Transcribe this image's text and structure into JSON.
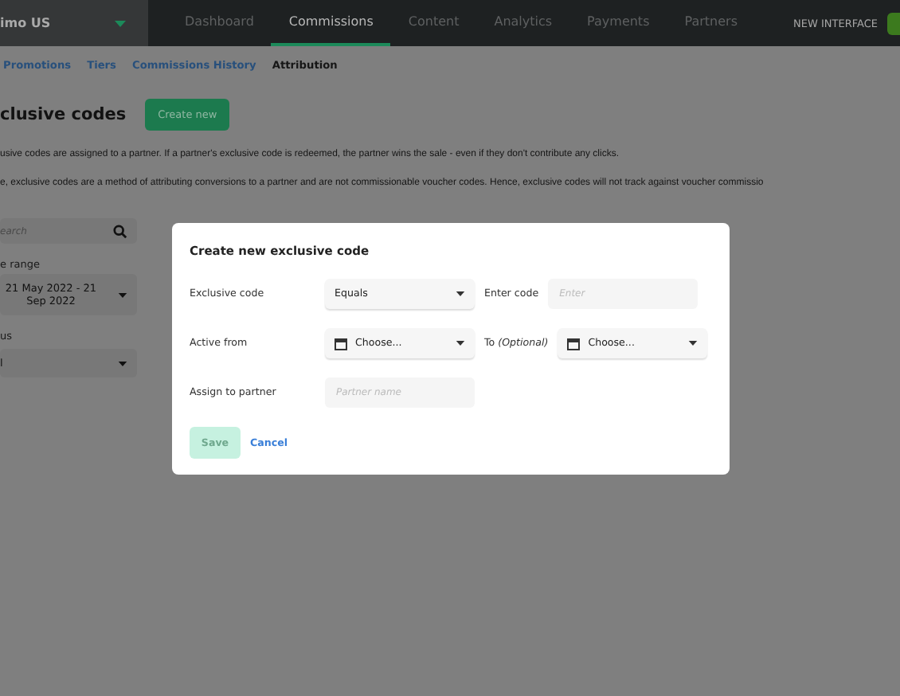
{
  "account": {
    "name": "imo US"
  },
  "nav": [
    {
      "label": "Dashboard",
      "selected": false
    },
    {
      "label": "Commissions",
      "selected": true
    },
    {
      "label": "Content",
      "selected": false
    },
    {
      "label": "Analytics",
      "selected": false
    },
    {
      "label": "Payments",
      "selected": false
    },
    {
      "label": "Partners",
      "selected": false
    }
  ],
  "new_interface": "NEW INTERFACE",
  "subnav": [
    {
      "label": "Promotions",
      "selected": false
    },
    {
      "label": "Tiers",
      "selected": false
    },
    {
      "label": "Commissions History",
      "selected": false
    },
    {
      "label": "Attribution",
      "selected": true
    }
  ],
  "heading": "clusive codes",
  "create_button": "Create new",
  "paragraphs": [
    "usive codes are assigned to a partner. If a partner's exclusive code is redeemed, the partner wins the sale - even if they don't contribute any clicks.",
    "e, exclusive codes are a method of attributing conversions to a partner and are not commissionable voucher codes. Hence, exclusive codes will not track against voucher commissio"
  ],
  "filters": {
    "search_placeholder": "earch",
    "date_label": "e range",
    "date_value": "21 May 2022 - 21 Sep 2022",
    "status_label": "us",
    "status_value": "l"
  },
  "modal": {
    "title": "Create new exclusive code",
    "code_label": "Exclusive code",
    "code_operator": "Equals",
    "enter_label": "Enter code",
    "enter_placeholder": "Enter",
    "from_label": "Active from",
    "from_value": "Choose...",
    "to_label": "To",
    "to_hint": "(Optional)",
    "to_value": "Choose...",
    "partner_label": "Assign to partner",
    "partner_placeholder": "Partner name",
    "save": "Save",
    "save_disabled": true,
    "cancel": "Cancel"
  }
}
